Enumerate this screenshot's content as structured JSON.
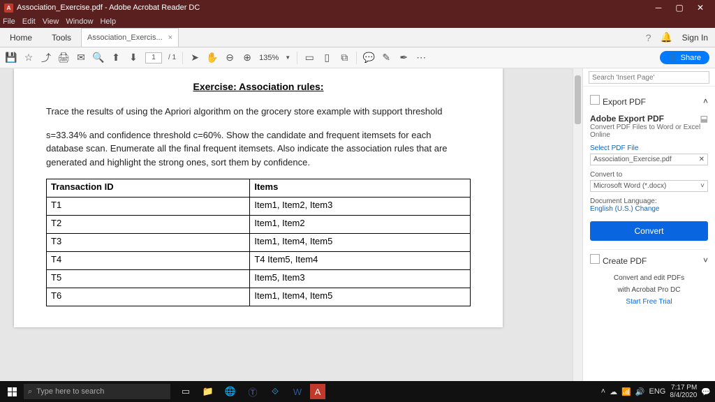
{
  "titlebar": {
    "icon": "A",
    "text": "Association_Exercise.pdf - Adobe Acrobat Reader DC"
  },
  "menubar": [
    "File",
    "Edit",
    "View",
    "Window",
    "Help"
  ],
  "tabbar": {
    "home": "Home",
    "tools": "Tools",
    "filetab": "Association_Exercis...",
    "close": "×",
    "signin": "Sign In"
  },
  "toolbar": {
    "page_current": "1",
    "page_total": "/ 1",
    "zoom": "135%",
    "share": "Share"
  },
  "document": {
    "title": "Exercise: Association rules:",
    "para1": "Trace the results of using the Apriori algorithm on the grocery store example with support threshold",
    "para2": "s=33.34% and confidence threshold c=60%. Show the candidate and frequent itemsets for each database scan. Enumerate all the final frequent itemsets. Also indicate the association rules that are generated and highlight the strong ones, sort them by confidence.",
    "headers": {
      "col1": "Transaction ID",
      "col2": "Items"
    },
    "rows": [
      {
        "id": "T1",
        "items": "Item1, Item2, Item3"
      },
      {
        "id": "T2",
        "items": " Item1, Item2"
      },
      {
        "id": "T3",
        "items": "Item1, Item4, Item5"
      },
      {
        "id": "T4",
        "items": "T4 Item5, Item4"
      },
      {
        "id": "T5",
        "items": "Item5, Item3"
      },
      {
        "id": "T6",
        "items": "Item1, Item4, Item5"
      }
    ]
  },
  "searchbar": {
    "placeholder": "Search 'Insert Page'"
  },
  "rightpane": {
    "export_title": "Export PDF",
    "adobe_export": "Adobe Export PDF",
    "convert_sub": "Convert PDF Files to Word or Excel Online",
    "select_label": "Select PDF File",
    "selected_file": "Association_Exercise.pdf",
    "convert_to": "Convert to",
    "convert_to_val": "Microsoft Word (*.docx)",
    "doclang_label": "Document Language:",
    "doclang_val": "English (U.S.) ",
    "change": "Change",
    "convert_btn": "Convert",
    "create_pdf": "Create PDF",
    "promo1": "Convert and edit PDFs",
    "promo2": "with Acrobat Pro DC",
    "trial": "Start Free Trial"
  },
  "taskbar": {
    "search_placeholder": "Type here to search",
    "lang": "ENG",
    "time": "7:17 PM",
    "date": "8/4/2020"
  }
}
